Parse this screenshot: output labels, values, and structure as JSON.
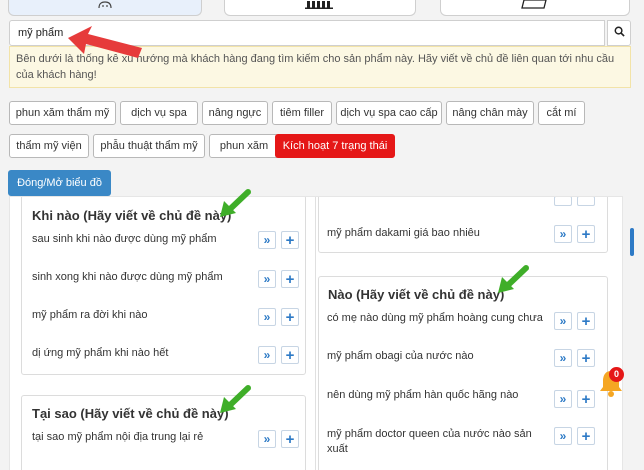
{
  "search": {
    "value": "mỹ phẩm"
  },
  "notice": {
    "text": "Bên dưới là thống kê xu hướng mà khách hàng đang tìm kiếm cho sản phẩm này. Hãy viết về chủ đề liên quan tới nhu cầu của khách hàng!"
  },
  "chips": [
    {
      "label": "phun xăm thẩm mỹ"
    },
    {
      "label": "dịch vụ spa"
    },
    {
      "label": "nâng ngực"
    },
    {
      "label": "tiêm filler"
    },
    {
      "label": "dịch vụ spa cao cấp"
    },
    {
      "label": "nâng chân mày"
    },
    {
      "label": "cắt mí"
    },
    {
      "label": "thẩm mỹ viện"
    },
    {
      "label": "phẫu thuật thẩm mỹ"
    },
    {
      "label": "phun xăm"
    },
    {
      "label": "Kích hoạt 7 trạng thái"
    }
  ],
  "toggle_chart": {
    "label": "Đóng/Mở biểu đồ"
  },
  "buttons": {
    "details_glyph": "»",
    "add_glyph": "+"
  },
  "cards": {
    "khi_nao": {
      "title": "Khi nào (Hãy viết về chủ đề này)",
      "items": [
        "sau sinh khi nào được dùng mỹ phẩm",
        "sinh xong khi nào được dùng mỹ phẩm",
        "mỹ phẩm ra đời khi nào",
        "dị ứng mỹ phẩm khi nào hết"
      ]
    },
    "tai_sao": {
      "title": "Tại sao (Hãy viết về chủ đề này)",
      "items": [
        "tại sao mỹ phẩm nội địa trung lại rẻ"
      ]
    },
    "top_right": {
      "items": [
        "mỹ phẩm dakami giá bao nhiêu"
      ]
    },
    "nao": {
      "title": "Nào (Hãy viết về chủ đề này)",
      "items": [
        "có mẹ nào dùng mỹ phẩm hoàng cung chưa",
        "mỹ phẩm obagi của nước nào",
        "nên dùng mỹ phẩm hàn quốc hãng nào",
        "mỹ phẩm doctor queen của nước nào sản xuất"
      ]
    }
  },
  "notifications": {
    "count": "0"
  },
  "colors": {
    "accent": "#3a88c6",
    "danger": "#e51717",
    "notice_bg": "#fcf8e3",
    "annotation_green": "#3fae29",
    "annotation_red": "#e63b3b",
    "bell": "#f5a623"
  },
  "icons": {
    "search": "search-icon",
    "bell": "bell-icon"
  }
}
